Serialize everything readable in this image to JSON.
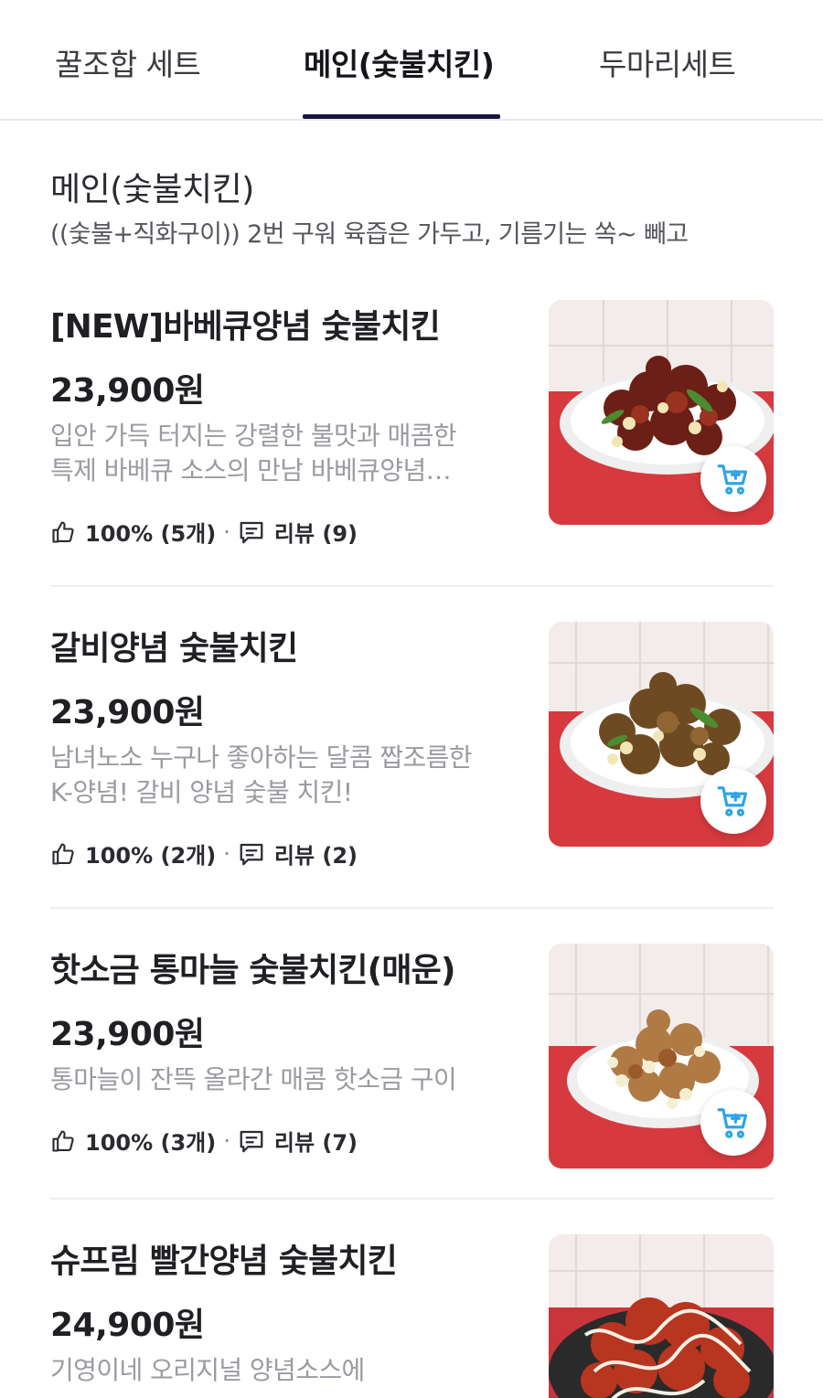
{
  "tabs": [
    {
      "label": "꿀조합 세트"
    },
    {
      "label": "메인(숯불치킨)"
    },
    {
      "label": "두마리세트"
    }
  ],
  "section": {
    "title": "메인(숯불치킨)",
    "description": "((숯불+직화구이)) 2번 구워 육즙은 가두고, 기름기는 쏙~ 빼고"
  },
  "items": [
    {
      "name": "[NEW]바베큐양념 숯불치킨",
      "price": "23,900원",
      "desc_line1": "입안 가득 터지는 강렬한 불맛과 매콤한",
      "desc_line2": "특제 바베큐 소스의 만남 바베큐양념…",
      "rating": "100% (5개)",
      "reviews": "리뷰 (9)",
      "image_icon": "dish-photo-bbq-chicken"
    },
    {
      "name": "갈비양념 숯불치킨",
      "price": "23,900원",
      "desc_line1": "남녀노소 누구나 좋아하는 달콤 짭조름한",
      "desc_line2": "K-양념! 갈비 양념 숯불 치킨!",
      "rating": "100% (2개)",
      "reviews": "리뷰 (2)",
      "image_icon": "dish-photo-galbi-chicken"
    },
    {
      "name": "핫소금 통마늘 숯불치킨(매운)",
      "price": "23,900원",
      "desc_line1": "통마늘이 잔뜩 올라간 매콤 핫소금 구이",
      "desc_line2": "",
      "rating": "100% (3개)",
      "reviews": "리뷰 (7)",
      "image_icon": "dish-photo-garlic-chicken"
    },
    {
      "name": "슈프림 빨간양념 숯불치킨",
      "price": "24,900원",
      "desc_line1": "기영이네 오리지널 양념소스에",
      "desc_line2": "",
      "rating": "",
      "reviews": "",
      "image_icon": "dish-photo-supreme-chicken"
    }
  ],
  "colors": {
    "tab_indicator": "#17163a",
    "cart_icon": "#2fa4e7",
    "table_red": "#d63a3f",
    "wall_tile": "#f3ecea"
  }
}
